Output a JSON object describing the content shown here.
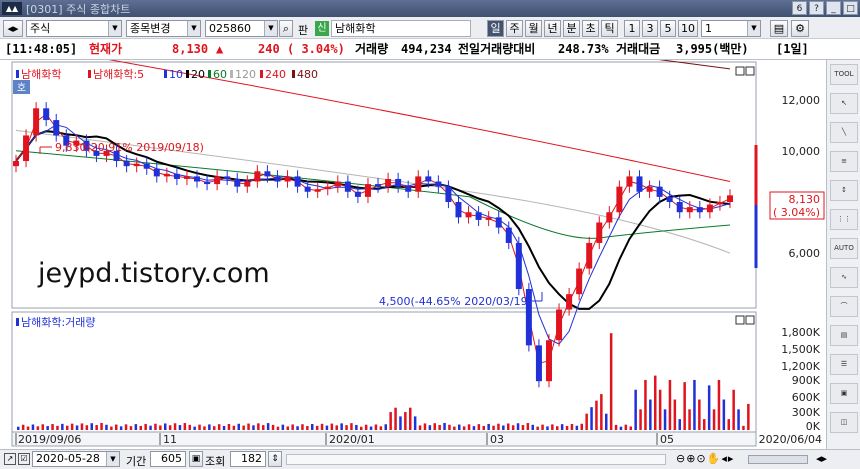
{
  "window": {
    "code": "0301",
    "title": "주식 종합차트",
    "buttons": [
      "6",
      "?",
      "_",
      "□"
    ]
  },
  "toolbar": {
    "market": "주식",
    "change_item": "종목변경",
    "code": "025860",
    "pan_label": "판",
    "shin_label": "신",
    "stock_name": "남해화학",
    "period_tabs": [
      "일",
      "주",
      "월",
      "년",
      "분",
      "초",
      "틱"
    ],
    "active_period": "일",
    "n_buttons": [
      "1",
      "3",
      "5",
      "10"
    ],
    "n_value": "1",
    "save_icon": "save-icon",
    "settings_icon": "settings-icon"
  },
  "infobar": {
    "time": "[11:48:05]",
    "price_label": "현재가",
    "price": "8,130",
    "arrow": "▲",
    "change": "240",
    "change_pct": "( 3.04%)",
    "volume_label": "거래량",
    "volume": "494,234",
    "prev_vol_label": "전일거래량대비",
    "prev_vol_ratio": "248.73%",
    "amount_label": "거래대금",
    "amount": "3,995(백만)",
    "period_tag": "[1일]"
  },
  "price_pane": {
    "legend": [
      "남해화학",
      "남해화학:5",
      "10",
      "20",
      "60",
      "120",
      "240",
      "480"
    ],
    "legend_colors": [
      "#e0141e",
      "#e0141e",
      "#2031d8",
      "#000000",
      "#0a7a2a",
      "#b5b5b5",
      "#e0141e",
      "#7a1010"
    ],
    "ho_button": "호",
    "y_labels": [
      "12,000",
      "10,000",
      "8,000",
      "6,000"
    ],
    "y_values": [
      12000,
      10000,
      8000,
      6000
    ],
    "high_annotation": "9,830(20.91% 2019/09/18)",
    "low_annotation": "4,500(-44.65% 2020/03/19)",
    "current_price_label": "8,130",
    "current_pct_label": "( 3.04%)",
    "watermark": "jeypd.tistory.com"
  },
  "volume_pane": {
    "legend": "남해화학:거래량",
    "y_labels": [
      "1,800K",
      "1,500K",
      "1,200K",
      "900K",
      "600K",
      "300K",
      "0K"
    ],
    "y_values": [
      1800,
      1500,
      1200,
      900,
      600,
      300,
      0
    ]
  },
  "x_axis": {
    "labels": [
      "2019/09/06",
      "11",
      "2020/01",
      "03",
      "05",
      "2020/06/04"
    ]
  },
  "bottombar": {
    "date": "2020-05-28",
    "period_label": "기간",
    "period_value": "605",
    "lookup_label": "조회",
    "lookup_value": "182"
  },
  "right_tools": [
    "TOOL",
    "↖",
    "╲",
    "≡",
    "↕",
    "⋮⋮",
    "AUTO",
    "∿",
    "⌒",
    "▤",
    "☰",
    "▣",
    "◫"
  ],
  "chart_data": {
    "type": "candlestick",
    "ylim": [
      4000,
      13000
    ],
    "x_start": "2019/09/06",
    "x_end": "2020/06/04",
    "close_series": [
      8800,
      9300,
      9830,
      9600,
      9300,
      9100,
      9200,
      9000,
      8900,
      9000,
      8800,
      8700,
      8750,
      8650,
      8500,
      8550,
      8450,
      8500,
      8400,
      8350,
      8500,
      8450,
      8300,
      8400,
      8600,
      8500,
      8400,
      8500,
      8300,
      8200,
      8250,
      8300,
      8400,
      8200,
      8100,
      8350,
      8300,
      8450,
      8300,
      8200,
      8500,
      8400,
      8300,
      8000,
      7700,
      7800,
      7650,
      7700,
      7500,
      7200,
      6300,
      5200,
      4500,
      5300,
      5900,
      6200,
      6700,
      7200,
      7600,
      7800,
      8300,
      8500,
      8200,
      8300,
      8100,
      8000,
      7800,
      7900,
      7800,
      7950,
      8000,
      8130
    ],
    "ma480": {
      "start": 11850,
      "end": 10600
    },
    "ma240": {
      "start": 11100,
      "end": 8400
    }
  }
}
